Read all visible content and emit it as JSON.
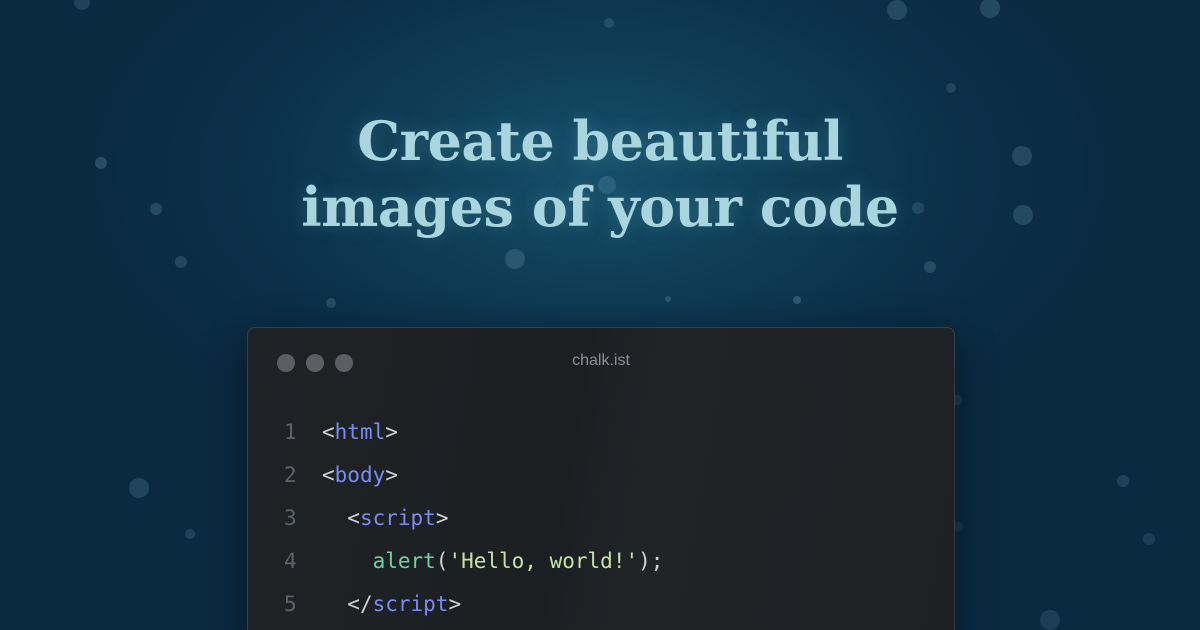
{
  "headline": {
    "line1": "Create beautiful",
    "line2": "images of your code"
  },
  "window": {
    "title": "chalk.ist"
  },
  "code": {
    "lines": [
      {
        "num": "1",
        "indent": "",
        "open": "<",
        "tag": "html",
        "close": ">"
      },
      {
        "num": "2",
        "indent": "",
        "open": "<",
        "tag": "body",
        "close": ">"
      },
      {
        "num": "3",
        "indent": "  ",
        "open": "<",
        "tag": "script",
        "close": ">"
      },
      {
        "num": "4",
        "indent": "    ",
        "fn": "alert",
        "paren_open": "(",
        "string": "'Hello, world!'",
        "paren_close": ");"
      },
      {
        "num": "5",
        "indent": "  ",
        "open": "</",
        "tag": "script",
        "close": ">"
      }
    ]
  },
  "colors": {
    "background": "#0b3049",
    "headline": "#a9d6de",
    "window_bg": "#1e2124",
    "tag": "#7b8cf0",
    "function": "#6fd3a0",
    "string": "#c6e3a6",
    "line_number": "#5d6368"
  }
}
